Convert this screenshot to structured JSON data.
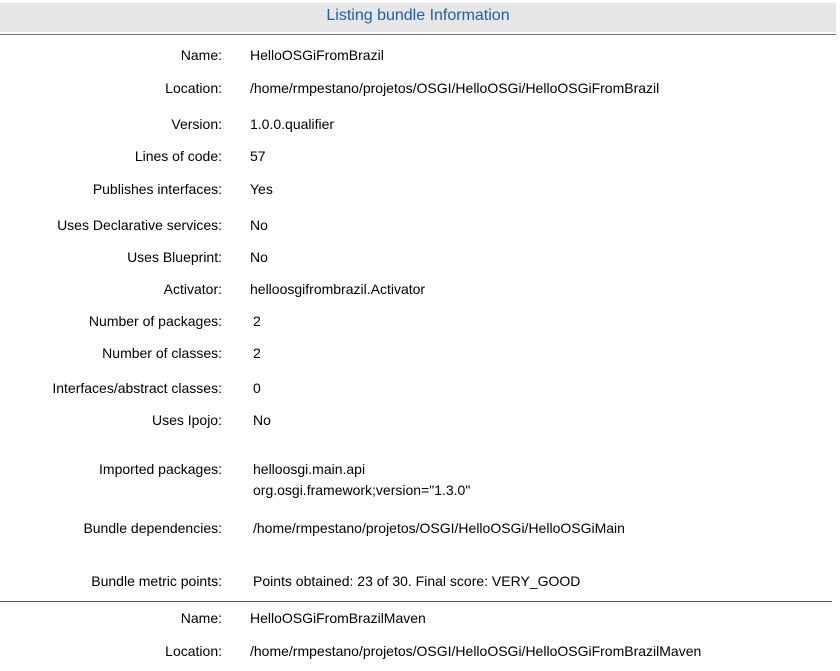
{
  "header": {
    "title": "Listing bundle Information",
    "title_color": "#1f5fa8",
    "background": "#e6e6e6"
  },
  "bundle1": {
    "name_label": "Name:",
    "name_value": "HelloOSGiFromBrazil",
    "location_label": "Location:",
    "location_value": "/home/rmpestano/projetos/OSGI/HelloOSGi/HelloOSGiFromBrazil",
    "version_label": "Version:",
    "version_value": "1.0.0.qualifier",
    "loc_label": "Lines of code:",
    "loc_value": "57",
    "publishes_label": "Publishes interfaces:",
    "publishes_value": "Yes",
    "declarative_label": "Uses Declarative services:",
    "declarative_value": "No",
    "blueprint_label": "Uses Blueprint:",
    "blueprint_value": "No",
    "activator_label": "Activator:",
    "activator_value": "helloosgifrombrazil.Activator",
    "packages_label": "Number of packages:",
    "packages_value": "2",
    "classes_label": "Number of classes:",
    "classes_value": "2",
    "interfaces_label": "Interfaces/abstract classes:",
    "interfaces_value": "0",
    "ipojo_label": "Uses Ipojo:",
    "ipojo_value": "No",
    "imported_label": "Imported packages:",
    "imported_values": [
      "helloosgi.main.api",
      "org.osgi.framework;version=\"1.3.0\""
    ],
    "dependencies_label": "Bundle dependencies:",
    "dependencies_value": "/home/rmpestano/projetos/OSGI/HelloOSGi/HelloOSGiMain",
    "metric_label": "Bundle metric points:",
    "metric_value": "Points obtained: 23 of 30. Final score: VERY_GOOD"
  },
  "bundle2": {
    "name_label": "Name:",
    "name_value": "HelloOSGiFromBrazilMaven",
    "location_label": "Location:",
    "location_value": "/home/rmpestano/projetos/OSGI/HelloOSGi/HelloOSGiFromBrazilMaven"
  }
}
